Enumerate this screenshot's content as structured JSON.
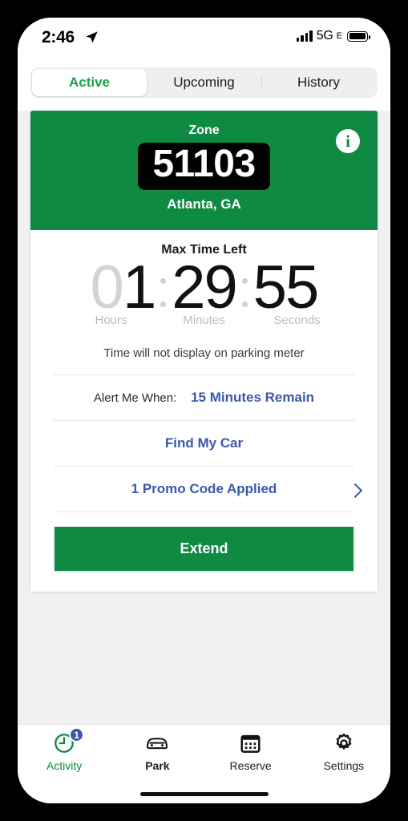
{
  "status_bar": {
    "time": "2:46",
    "location_icon": "location-arrow-icon",
    "network": "5G",
    "network_sub": "E",
    "signal_icon": "signal-bars-icon",
    "battery_icon": "battery-icon"
  },
  "tabs_segment": {
    "items": [
      {
        "label": "Active",
        "active": true
      },
      {
        "label": "Upcoming",
        "active": false
      },
      {
        "label": "History",
        "active": false
      }
    ]
  },
  "zone_card": {
    "zone_label": "Zone",
    "zone_number": "51103",
    "city": "Atlanta, GA",
    "info_icon": "info-icon",
    "info_glyph": "i",
    "bg_color": "#0e8a43"
  },
  "timer": {
    "title": "Max Time Left",
    "hours": "01",
    "hours_dim_digit": "0",
    "hours_bright_digit": "1",
    "minutes": "29",
    "seconds": "55",
    "labels": {
      "hours": "Hours",
      "minutes": "Minutes",
      "seconds": "Seconds"
    }
  },
  "rows": {
    "meter_note": "Time will not display on parking meter",
    "alert_label": "Alert Me When:",
    "alert_value": "15 Minutes Remain",
    "find_my_car": "Find My Car",
    "promo": "1 Promo Code Applied",
    "chevron_icon": "chevron-right-icon"
  },
  "extend_button": {
    "label": "Extend",
    "color": "#0e8a43"
  },
  "bottom_nav": {
    "items": [
      {
        "label": "Activity",
        "icon": "clock-icon",
        "active": true,
        "badge": "1"
      },
      {
        "label": "Park",
        "icon": "car-icon",
        "active": false
      },
      {
        "label": "Reserve",
        "icon": "calendar-icon",
        "active": false
      },
      {
        "label": "Settings",
        "icon": "gear-icon",
        "active": false
      }
    ]
  },
  "colors": {
    "brand_green": "#0e8a43",
    "link_blue": "#3b59ab",
    "badge_blue": "#3b59ab"
  }
}
